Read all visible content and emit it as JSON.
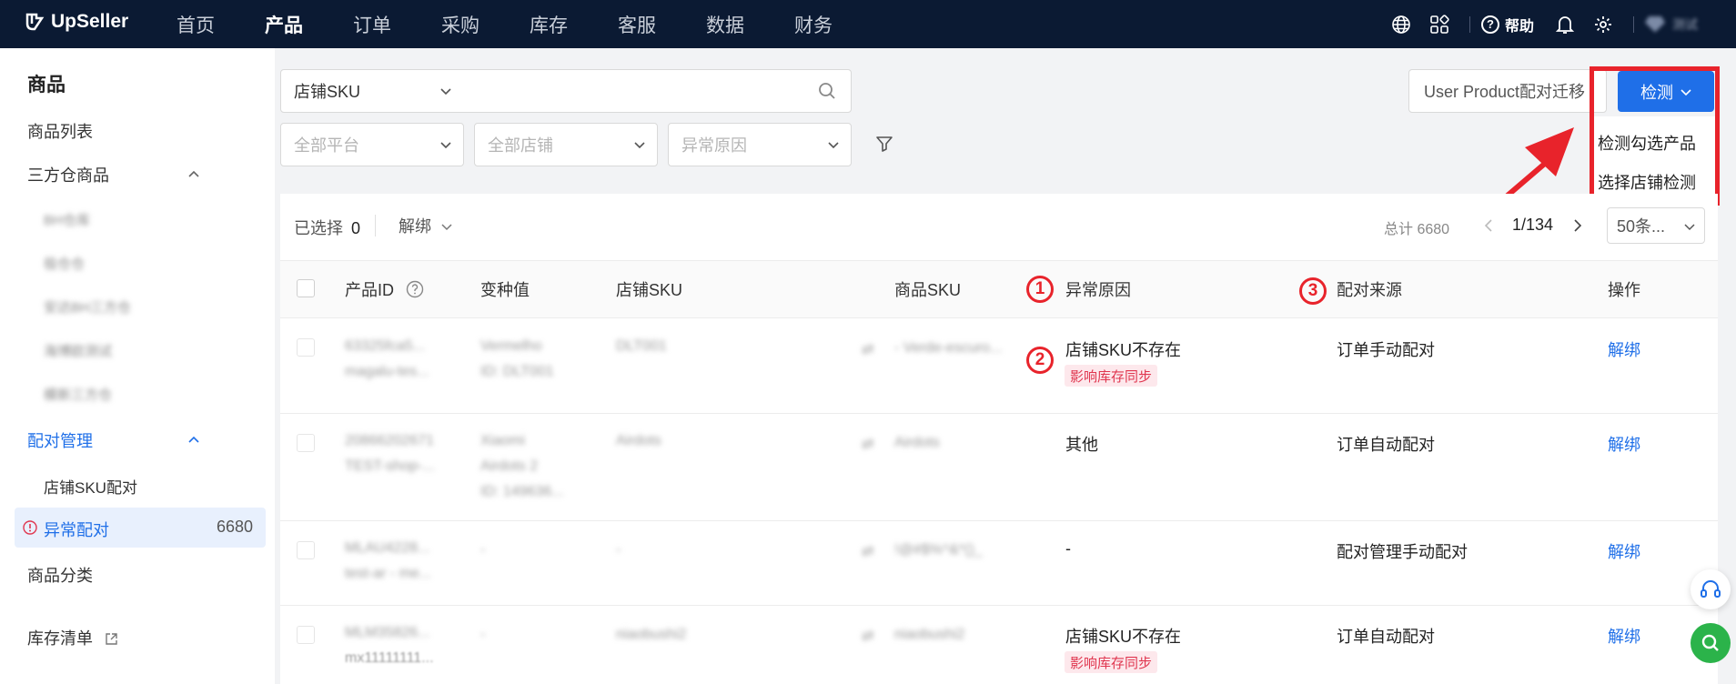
{
  "app": {
    "brand": "UpSeller"
  },
  "nav": {
    "items": [
      "首页",
      "产品",
      "订单",
      "采购",
      "库存",
      "客服",
      "数据",
      "财务"
    ],
    "active_index": 1
  },
  "top_right": {
    "help_label": "帮助",
    "user_name": "测试"
  },
  "sidebar": {
    "title": "商品",
    "product_list": "商品列表",
    "third_party": "三方仓商品",
    "third_party_blurred": [
      "BH仓库",
      "极仓仓",
      "安达BH三方仓",
      "海博欧测试",
      "模新三方仓"
    ],
    "pairing_mgmt": "配对管理",
    "store_sku_pairing": "店铺SKU配对",
    "abnormal_pairing": "异常配对",
    "abnormal_count": "6680",
    "category": "商品分类",
    "inventory_list": "库存清单"
  },
  "filters": {
    "sku_type": "店铺SKU",
    "platform_placeholder": "全部平台",
    "store_placeholder": "全部店铺",
    "reason_placeholder": "异常原因"
  },
  "actions": {
    "migrate_label": "User Product配对迁移",
    "detect_label": "检测",
    "detect_menu": [
      "检测勾选产品",
      "选择店铺检测"
    ]
  },
  "toolbar": {
    "selected_label": "已选择",
    "selected_count": "0",
    "unbind_label": "解绑",
    "total_label": "总计 6680",
    "page": "1/134",
    "page_size": "50条..."
  },
  "table": {
    "headers": {
      "product_id": "产品ID",
      "variant": "变种值",
      "store_sku": "店铺SKU",
      "product_sku": "商品SKU",
      "reason": "异常原因",
      "source": "配对来源",
      "action": "操作"
    },
    "rows": [
      {
        "id1": "63325fca5...",
        "id2": "magalu-tes...",
        "variant1": "Vermelho",
        "variant2": "ID: DLT001",
        "variant3": "",
        "store_sku": "DLT001",
        "product_sku": "- Verde-escuro...",
        "reason": "店铺SKU不存在",
        "tag": "影响库存同步",
        "source": "订单手动配对",
        "action": "解绑"
      },
      {
        "id1": "20866202671",
        "id2": "TEST-shop-...",
        "variant1": "Xiaomi",
        "variant2": "Airdots 2",
        "variant3": "ID: 149636...",
        "store_sku": "Airdots",
        "product_sku": "Airdots",
        "reason": "其他",
        "tag": "",
        "source": "订单自动配对",
        "action": "解绑"
      },
      {
        "id1": "MLAU4228...",
        "id2": "test-ar - me...",
        "variant1": "-",
        "variant2": "",
        "variant3": "",
        "store_sku": "-",
        "product_sku": "!@#$%^&*()_",
        "reason": "-",
        "tag": "",
        "source": "配对管理手动配对",
        "action": "解绑"
      },
      {
        "id1": "MLM35826...",
        "id2": "mx11111111...",
        "variant1": "-",
        "variant2": "",
        "variant3": "",
        "store_sku": "niaobushi2",
        "product_sku": "niaobushi2",
        "reason": "店铺SKU不存在",
        "tag": "影响库存同步",
        "source": "订单自动配对",
        "action": "解绑"
      }
    ]
  },
  "annotations": {
    "markers": [
      "1",
      "2",
      "3"
    ],
    "color": "#e8232b"
  },
  "colors": {
    "nav_bg": "#0b1a33",
    "primary": "#1f6fe8",
    "danger": "#e0364f",
    "annotation": "#e8232b"
  }
}
